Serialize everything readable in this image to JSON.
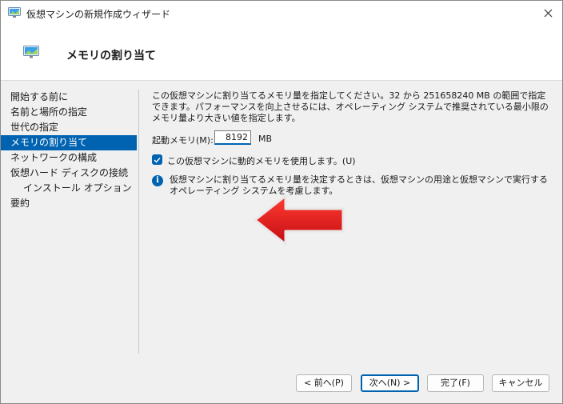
{
  "window": {
    "title": "仮想マシンの新規作成ウィザード",
    "close_glyph": "✕"
  },
  "header": {
    "title": "メモリの割り当て"
  },
  "nav": {
    "items": [
      {
        "label": "開始する前に",
        "active": false,
        "indent": false
      },
      {
        "label": "名前と場所の指定",
        "active": false,
        "indent": false
      },
      {
        "label": "世代の指定",
        "active": false,
        "indent": false
      },
      {
        "label": "メモリの割り当て",
        "active": true,
        "indent": false
      },
      {
        "label": "ネットワークの構成",
        "active": false,
        "indent": false
      },
      {
        "label": "仮想ハード ディスクの接続",
        "active": false,
        "indent": false
      },
      {
        "label": "インストール オプション",
        "active": false,
        "indent": true
      },
      {
        "label": "要約",
        "active": false,
        "indent": false
      }
    ]
  },
  "content": {
    "description": "この仮想マシンに割り当てるメモリ量を指定してください。32 から 251658240 MB の範囲で指定できます。パフォーマンスを向上させるには、オペレーティング システムで推奨されている最小限のメモリ量より大きい値を指定します。",
    "memory_label": "起動メモリ(M):",
    "memory_value": "8192",
    "memory_unit": "MB",
    "dynamic_memory_label": "この仮想マシンに動的メモリを使用します。(U)",
    "dynamic_memory_checked": true,
    "info_text": "仮想マシンに割り当てるメモリ量を決定するときは、仮想マシンの用途と仮想マシンで実行するオペレーティング システムを考慮します。",
    "info_glyph": "i"
  },
  "footer": {
    "prev_label": "< 前へ(P)",
    "next_label": "次へ(N) >",
    "finish_label": "完了(F)",
    "cancel_label": "キャンセル"
  },
  "colors": {
    "accent": "#0063b1",
    "annotation_arrow": "#e4121b",
    "panel_bg": "#f0f0f0"
  },
  "icons": {
    "app": "monitor-icon",
    "header": "monitor-icon",
    "close": "close-icon",
    "check": "checkmark-icon",
    "info": "info-icon",
    "annotation": "red-arrow-icon"
  }
}
